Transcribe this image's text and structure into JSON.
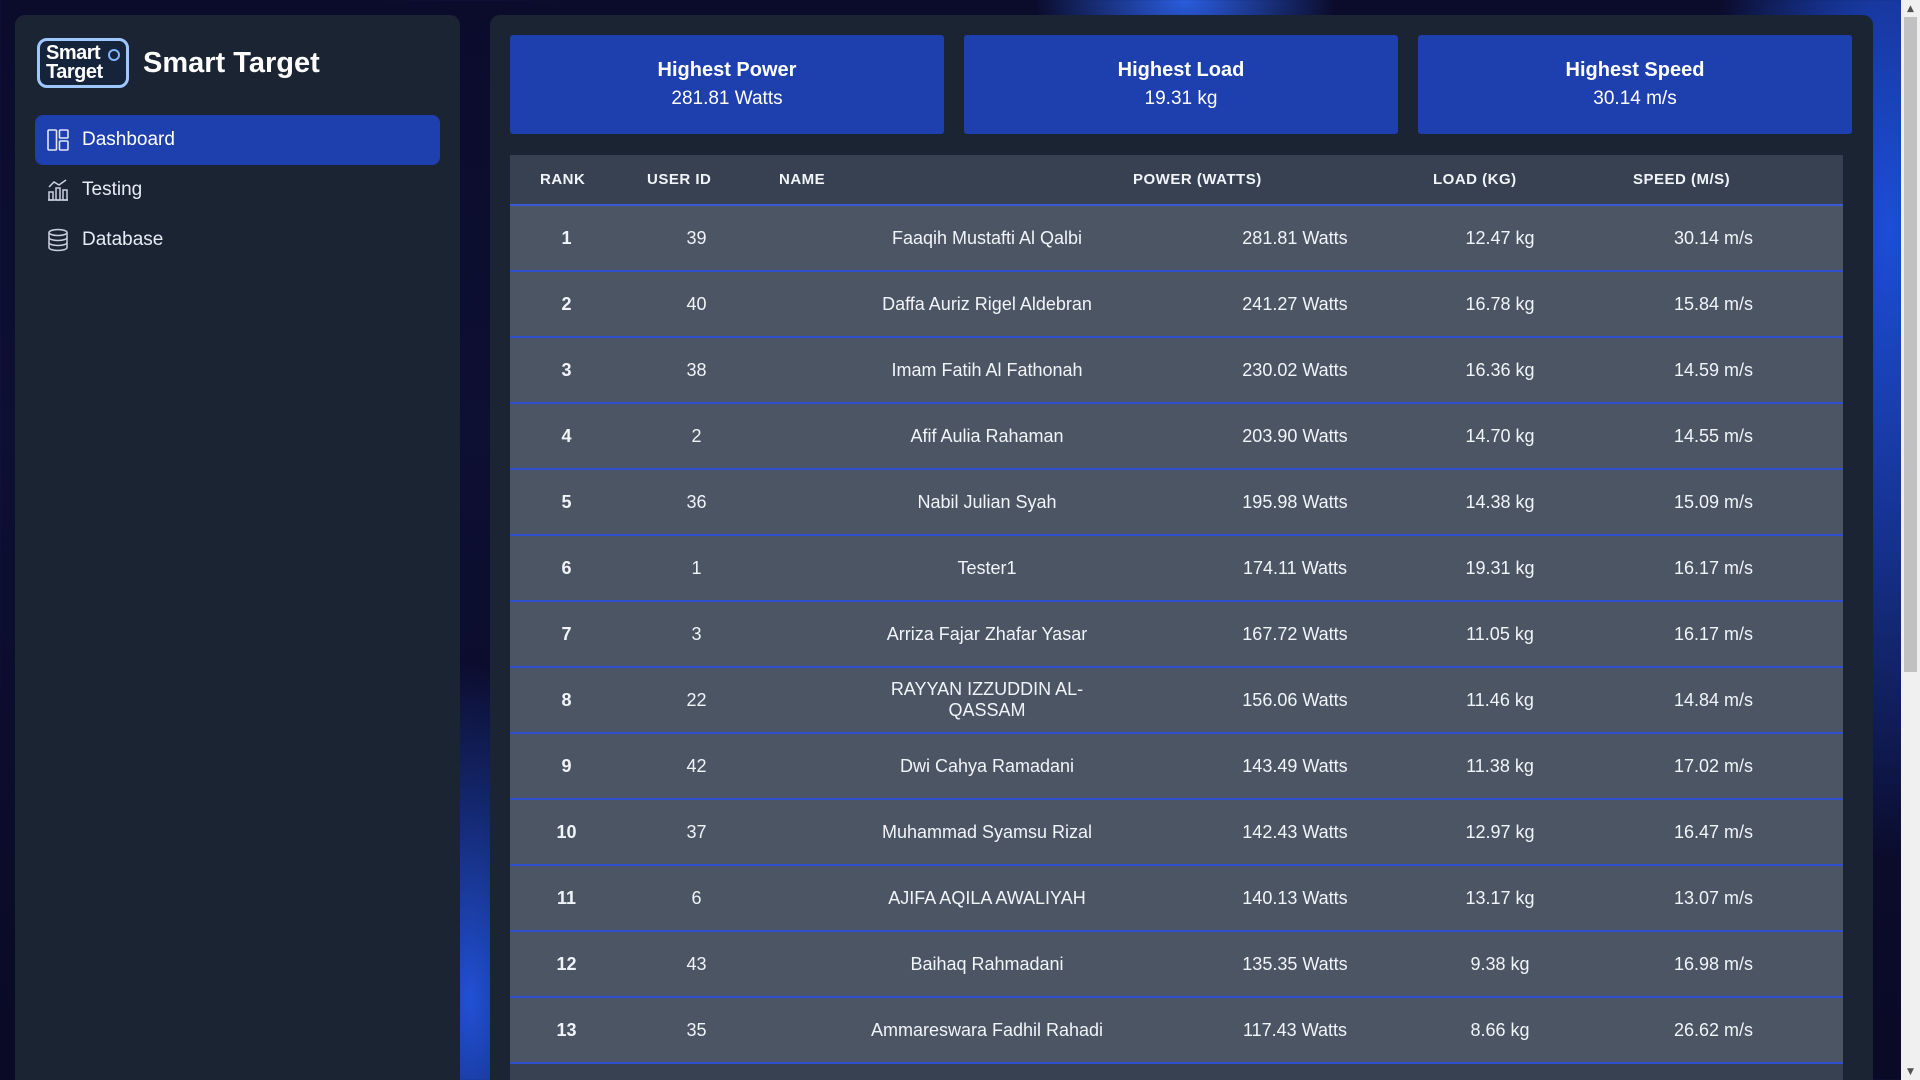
{
  "app": {
    "logo_line1": "Smart",
    "logo_line2": "Target",
    "title": "Smart Target"
  },
  "nav": [
    {
      "label": "Dashboard",
      "icon": "dashboard-icon",
      "active": true
    },
    {
      "label": "Testing",
      "icon": "chart-icon",
      "active": false
    },
    {
      "label": "Database",
      "icon": "database-icon",
      "active": false
    }
  ],
  "cards": [
    {
      "title": "Highest Power",
      "value": "281.81 Watts"
    },
    {
      "title": "Highest Load",
      "value": "19.31 kg"
    },
    {
      "title": "Highest Speed",
      "value": "30.14 m/s"
    }
  ],
  "table": {
    "headers": [
      "RANK",
      "USER ID",
      "NAME",
      "POWER (WATTS)",
      "LOAD (KG)",
      "SPEED (M/S)"
    ],
    "rows": [
      [
        "1",
        "39",
        "Faaqih Mustafti Al Qalbi",
        "281.81 Watts",
        "12.47 kg",
        "30.14 m/s"
      ],
      [
        "2",
        "40",
        "Daffa Auriz Rigel Aldebran",
        "241.27 Watts",
        "16.78 kg",
        "15.84 m/s"
      ],
      [
        "3",
        "38",
        "Imam Fatih Al Fathonah",
        "230.02 Watts",
        "16.36 kg",
        "14.59 m/s"
      ],
      [
        "4",
        "2",
        "Afif Aulia Rahaman",
        "203.90 Watts",
        "14.70 kg",
        "14.55 m/s"
      ],
      [
        "5",
        "36",
        "Nabil Julian Syah",
        "195.98 Watts",
        "14.38 kg",
        "15.09 m/s"
      ],
      [
        "6",
        "1",
        "Tester1",
        "174.11 Watts",
        "19.31 kg",
        "16.17 m/s"
      ],
      [
        "7",
        "3",
        "Arriza Fajar Zhafar Yasar",
        "167.72 Watts",
        "11.05 kg",
        "16.17 m/s"
      ],
      [
        "8",
        "22",
        "RAYYAN IZZUDDIN AL-QASSAM",
        "156.06 Watts",
        "11.46 kg",
        "14.84 m/s"
      ],
      [
        "9",
        "42",
        "Dwi Cahya Ramadani",
        "143.49 Watts",
        "11.38 kg",
        "17.02 m/s"
      ],
      [
        "10",
        "37",
        "Muhammad Syamsu Rizal",
        "142.43 Watts",
        "12.97 kg",
        "16.47 m/s"
      ],
      [
        "11",
        "6",
        "AJIFA AQILA AWALIYAH",
        "140.13 Watts",
        "13.17 kg",
        "13.07 m/s"
      ],
      [
        "12",
        "43",
        "Baihaq Rahmadani",
        "135.35 Watts",
        "9.38 kg",
        "16.98 m/s"
      ],
      [
        "13",
        "35",
        "Ammareswara Fadhil Rahadi",
        "117.43 Watts",
        "8.66 kg",
        "26.62 m/s"
      ]
    ]
  },
  "colors": {
    "accent": "#1e40af",
    "panel": "#1b2433",
    "row": "#4b5563",
    "row_divider": "#2f4fd0"
  }
}
